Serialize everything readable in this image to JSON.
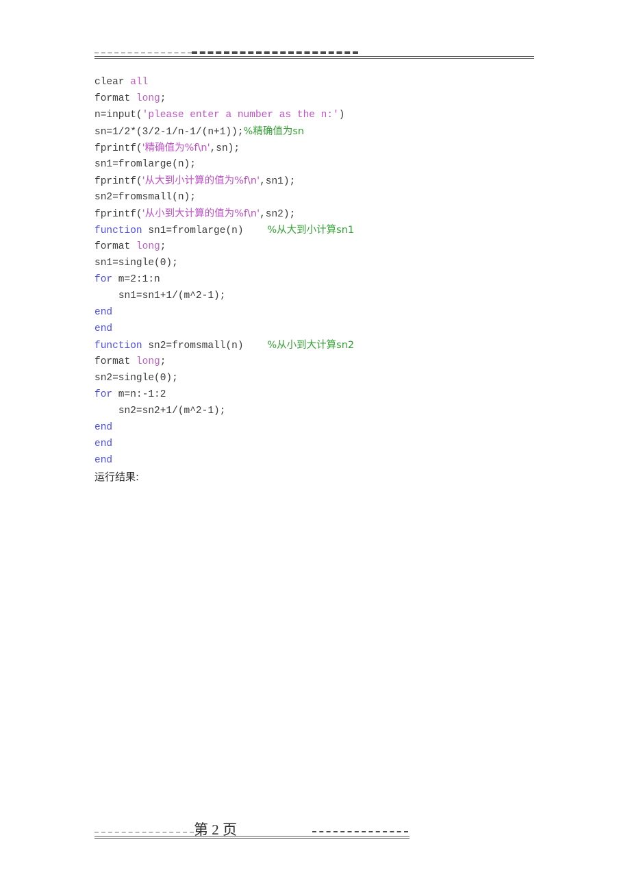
{
  "document": {
    "page_number_text": "第 2 页",
    "result_label": "运行结果:"
  },
  "code": {
    "lines": [
      {
        "indent": "",
        "tokens": [
          {
            "text": "clear ",
            "type": "plain"
          },
          {
            "text": "all",
            "type": "keyword"
          }
        ]
      },
      {
        "indent": "",
        "tokens": [
          {
            "text": "format ",
            "type": "plain"
          },
          {
            "text": "long",
            "type": "keyword"
          },
          {
            "text": ";",
            "type": "plain"
          }
        ]
      },
      {
        "indent": "",
        "tokens": [
          {
            "text": "n=input(",
            "type": "plain"
          },
          {
            "text": "'please enter a number as the n:'",
            "type": "string"
          },
          {
            "text": ")",
            "type": "plain"
          }
        ]
      },
      {
        "indent": "",
        "tokens": [
          {
            "text": "sn=1/2*(3/2-1/n-1/(n+1));",
            "type": "plain"
          },
          {
            "text": "%精确值为sn",
            "type": "comment"
          }
        ]
      },
      {
        "indent": "",
        "tokens": [
          {
            "text": "fprintf(",
            "type": "plain"
          },
          {
            "text": "'精确值为%f\\n'",
            "type": "string"
          },
          {
            "text": ",sn);",
            "type": "plain"
          }
        ]
      },
      {
        "indent": "",
        "tokens": [
          {
            "text": "sn1=fromlarge(n);",
            "type": "plain"
          }
        ]
      },
      {
        "indent": "",
        "tokens": [
          {
            "text": "fprintf(",
            "type": "plain"
          },
          {
            "text": "'从大到小计算的值为%f\\n'",
            "type": "string"
          },
          {
            "text": ",sn1);",
            "type": "plain"
          }
        ]
      },
      {
        "indent": "",
        "tokens": [
          {
            "text": "sn2=fromsmall(n);",
            "type": "plain"
          }
        ]
      },
      {
        "indent": "",
        "tokens": [
          {
            "text": "fprintf(",
            "type": "plain"
          },
          {
            "text": "'从小到大计算的值为%f\\n'",
            "type": "string"
          },
          {
            "text": ",sn2);",
            "type": "plain"
          }
        ]
      },
      {
        "indent": "",
        "tokens": [
          {
            "text": "function",
            "type": "control"
          },
          {
            "text": " sn1=fromlarge(n)    ",
            "type": "plain"
          },
          {
            "text": "%从大到小计算sn1",
            "type": "comment"
          }
        ]
      },
      {
        "indent": "",
        "tokens": [
          {
            "text": "format ",
            "type": "plain"
          },
          {
            "text": "long",
            "type": "keyword"
          },
          {
            "text": ";",
            "type": "plain"
          }
        ]
      },
      {
        "indent": "",
        "tokens": [
          {
            "text": "sn1=single(0);",
            "type": "plain"
          }
        ]
      },
      {
        "indent": "",
        "tokens": [
          {
            "text": "for",
            "type": "control"
          },
          {
            "text": " m=2:1:n",
            "type": "plain"
          }
        ]
      },
      {
        "indent": "    ",
        "tokens": [
          {
            "text": "sn1=sn1+1/(m^2-1);",
            "type": "plain"
          }
        ]
      },
      {
        "indent": "",
        "tokens": [
          {
            "text": "end",
            "type": "control"
          }
        ]
      },
      {
        "indent": "",
        "tokens": [
          {
            "text": "end",
            "type": "control"
          }
        ]
      },
      {
        "indent": "",
        "tokens": [
          {
            "text": "function",
            "type": "control"
          },
          {
            "text": " sn2=fromsmall(n)    ",
            "type": "plain"
          },
          {
            "text": "%从小到大计算sn2",
            "type": "comment"
          }
        ]
      },
      {
        "indent": "",
        "tokens": [
          {
            "text": "format ",
            "type": "plain"
          },
          {
            "text": "long",
            "type": "keyword"
          },
          {
            "text": ";",
            "type": "plain"
          }
        ]
      },
      {
        "indent": "",
        "tokens": [
          {
            "text": "sn2=single(0);",
            "type": "plain"
          }
        ]
      },
      {
        "indent": "",
        "tokens": [
          {
            "text": "for",
            "type": "control"
          },
          {
            "text": " m=n:-1:2",
            "type": "plain"
          }
        ]
      },
      {
        "indent": "    ",
        "tokens": [
          {
            "text": "sn2=sn2+1/(m^2-1);",
            "type": "plain"
          }
        ]
      },
      {
        "indent": "",
        "tokens": [
          {
            "text": "end",
            "type": "control"
          }
        ]
      },
      {
        "indent": "",
        "tokens": [
          {
            "text": "end",
            "type": "control"
          }
        ]
      },
      {
        "indent": "",
        "tokens": [
          {
            "text": "end",
            "type": "control"
          }
        ]
      }
    ]
  },
  "colors": {
    "plain": "#3b3b3b",
    "keyword": "#bf5fbf",
    "string": "#c050c8",
    "control": "#4a4aee",
    "comment": "#35a035",
    "rule_light": "#b9b9b9",
    "rule_dark": "#4a4a4a",
    "rule_solid": "#5a5a5a",
    "background": "#ffffff"
  }
}
